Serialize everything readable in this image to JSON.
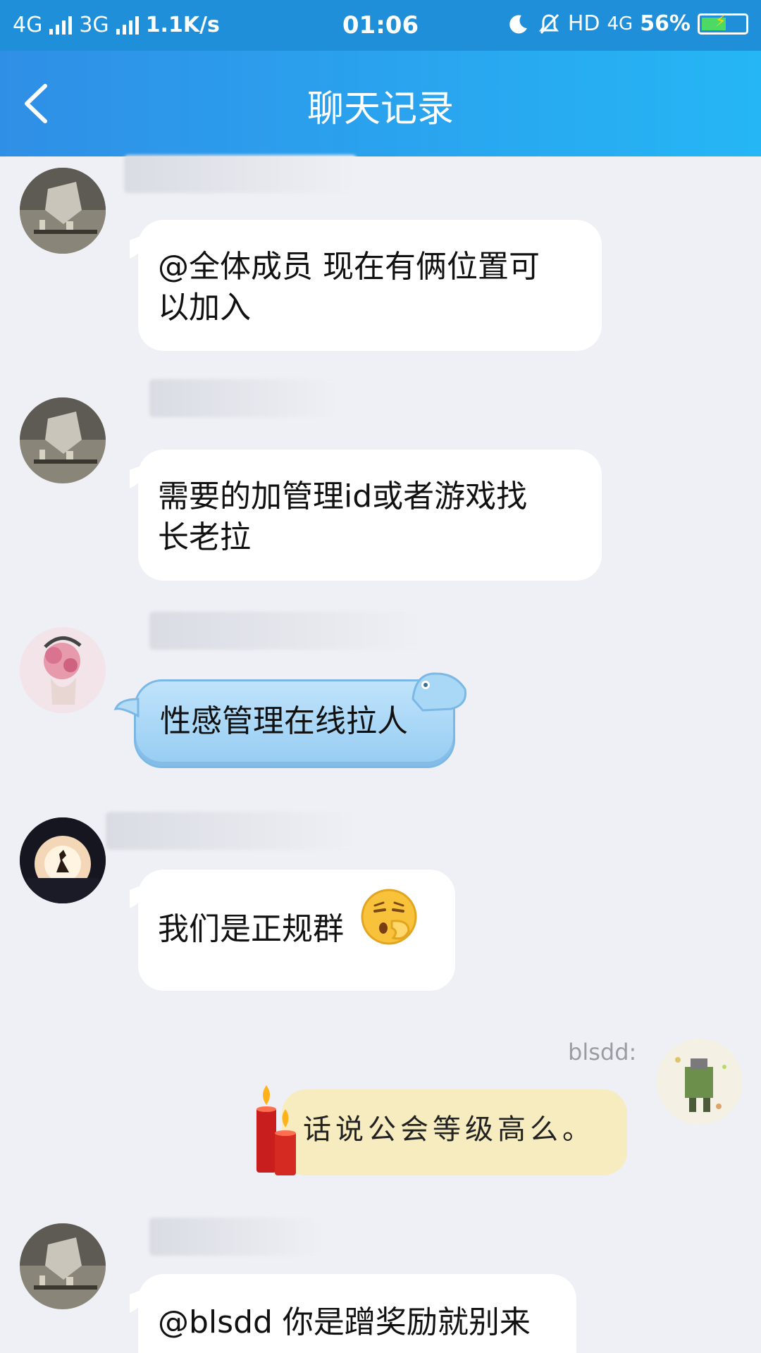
{
  "status_bar": {
    "network_1": "4G",
    "network_2": "3G",
    "speed": "1.1K/s",
    "time": "01:06",
    "hd": "HD",
    "network_3": "4G",
    "battery": "56%",
    "battery_level": 0.56
  },
  "header": {
    "title": "聊天记录",
    "back_icon": "chevron-left-icon"
  },
  "messages": [
    {
      "sender": "",
      "text_line1": "@全体成员 现在有俩位置可",
      "text_line2": "以加入"
    },
    {
      "sender": "",
      "text_line1": "需要的加管理id或者游戏找",
      "text_line2": "长老拉"
    },
    {
      "sender": "",
      "text": "性感管理在线拉人"
    },
    {
      "sender": "",
      "text": "我们是正规群",
      "emoji": "pensive-emoji"
    },
    {
      "sender": "blsdd:",
      "text": "话说公会等级高么。",
      "outgoing": true
    },
    {
      "sender": "",
      "text": "@blsdd 你是蹭奖励就别来"
    }
  ],
  "colors": {
    "header_start": "#2f8fe6",
    "header_end": "#25b6f5",
    "background": "#eef0f5",
    "bubble": "#ffffff",
    "blue_bubble": "#a8d6f6",
    "yellow_bubble": "#f6ecbf"
  }
}
